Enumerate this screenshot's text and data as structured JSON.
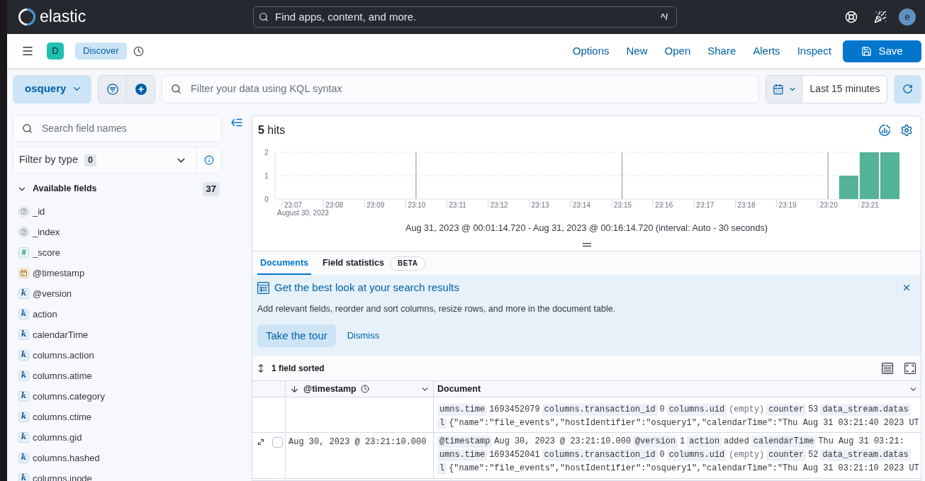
{
  "top_bar": {
    "logo_text": "elastic",
    "search": {
      "placeholder": "Find apps, content, and more.",
      "shortcut": "^/"
    },
    "avatar": "e"
  },
  "app_bar": {
    "app_initial": "D",
    "breadcrumb": "Discover",
    "links": [
      "Options",
      "New",
      "Open",
      "Share",
      "Alerts",
      "Inspect"
    ],
    "save_label": "Save"
  },
  "query_bar": {
    "data_view": "osquery",
    "query": {
      "placeholder": "Filter your data using KQL syntax"
    },
    "time_range": "Last 15 minutes"
  },
  "sidebar": {
    "search": {
      "placeholder": "Search field names"
    },
    "type_filter": {
      "label": "Filter by type",
      "count": "0"
    },
    "section": {
      "title": "Available fields",
      "count": "37",
      "expanded": true
    },
    "fields": [
      {
        "name": "_id",
        "kind": "unknown"
      },
      {
        "name": "_index",
        "kind": "unknown"
      },
      {
        "name": "_score",
        "kind": "number",
        "token": "#"
      },
      {
        "name": "@timestamp",
        "kind": "date"
      },
      {
        "name": "@version",
        "kind": "keyword",
        "token": "k"
      },
      {
        "name": "action",
        "kind": "keyword",
        "token": "k"
      },
      {
        "name": "calendarTime",
        "kind": "keyword",
        "token": "k"
      },
      {
        "name": "columns.action",
        "kind": "keyword",
        "token": "k"
      },
      {
        "name": "columns.atime",
        "kind": "keyword",
        "token": "k"
      },
      {
        "name": "columns.category",
        "kind": "keyword",
        "token": "k"
      },
      {
        "name": "columns.ctime",
        "kind": "keyword",
        "token": "k"
      },
      {
        "name": "columns.gid",
        "kind": "keyword",
        "token": "k"
      },
      {
        "name": "columns.hashed",
        "kind": "keyword",
        "token": "k"
      },
      {
        "name": "columns.inode",
        "kind": "keyword",
        "token": "k"
      }
    ]
  },
  "results": {
    "hits": "**5** hits",
    "chart_data": {
      "type": "bar",
      "xlabel": "August 30, 2023",
      "categories": [
        "23:07",
        null,
        "23:08",
        null,
        "23:09",
        null,
        "23:10",
        null,
        "23:11",
        null,
        "23:12",
        null,
        "23:13",
        null,
        "23:14",
        null,
        "23:15",
        null,
        "23:16",
        null,
        "23:17",
        null,
        "23:18",
        null,
        "23:19",
        null,
        "23:20",
        null,
        "23:21",
        null
      ],
      "values": [
        0,
        0,
        0,
        0,
        0,
        0,
        0,
        0,
        0,
        0,
        0,
        0,
        0,
        0,
        0,
        0,
        0,
        0,
        0,
        0,
        0,
        0,
        0,
        0,
        0,
        0,
        0,
        1,
        2,
        2
      ],
      "ylim": [
        0,
        2
      ],
      "yticks": [
        0,
        1,
        2
      ],
      "ref_lines": [
        {
          "axis": "y",
          "value": 1
        },
        {
          "axis": "y",
          "value": 2
        },
        {
          "axis": "x",
          "value": "23:10"
        },
        {
          "axis": "x",
          "value": "23:15"
        },
        {
          "axis": "x",
          "value": "23:20"
        }
      ]
    },
    "time_range_text": "Aug 31, 2023 @ 00:01:14.720 - Aug 31, 2023 @ 00:16:14.720 (interval: Auto - 30 seconds)"
  },
  "tabs": [
    {
      "label": "Documents",
      "selected": true
    },
    {
      "label": "Field statistics",
      "selected": false,
      "badge": "BETA"
    }
  ],
  "callout": {
    "title": "Get the best look at your search results",
    "body": "Add relevant fields, reorder and sort columns, resize rows, and more in the document table.",
    "buttons": [
      {
        "label": "Take the tour",
        "kind": "primary"
      },
      {
        "label": "Dismiss",
        "kind": "link"
      }
    ]
  },
  "grid": {
    "sort_summary": "1 field sorted",
    "columns": [
      {
        "label": "@timestamp",
        "kind": "time"
      },
      {
        "label": "Document",
        "kind": "document"
      }
    ],
    "rows": [
      {
        "kind": "clipped",
        "lines": [
          [
            {
              "text": "umns.time",
              "kind": "key"
            },
            {
              "text": "1693452079",
              "kind": "value"
            },
            {
              "text": "columns.transaction_id",
              "kind": "key"
            },
            {
              "text": "0",
              "kind": "value"
            },
            {
              "text": "columns.uid",
              "kind": "key"
            },
            {
              "text": "(empty)",
              "kind": "empty"
            },
            {
              "text": "counter",
              "kind": "key"
            },
            {
              "text": "53",
              "kind": "value"
            },
            {
              "text": "data_stream.datas",
              "kind": "key"
            }
          ],
          [
            {
              "text": "l",
              "kind": "key"
            },
            {
              "text": "{\"name\":\"file_events\",\"hostIdentifier\":\"osquery1\",\"calendarTime\":\"Thu Aug 31 03:21:40 2023 UT",
              "kind": "value"
            }
          ]
        ]
      },
      {
        "kind": "full",
        "timestamp": "Aug 30, 2023 @ 23:21:10.000",
        "checked": false,
        "lines": [
          [
            {
              "text": "@timestamp",
              "kind": "key"
            },
            {
              "text": "Aug 30, 2023 @ 23:21:10.000",
              "kind": "value"
            },
            {
              "text": "@version",
              "kind": "key"
            },
            {
              "text": "1",
              "kind": "value"
            },
            {
              "text": "action",
              "kind": "key"
            },
            {
              "text": "added",
              "kind": "value"
            },
            {
              "text": "calendarTime",
              "kind": "key"
            },
            {
              "text": "Thu Aug 31 03:21:",
              "kind": "value"
            }
          ],
          [
            {
              "text": "umns.time",
              "kind": "key"
            },
            {
              "text": "1693452041",
              "kind": "value"
            },
            {
              "text": "columns.transaction_id",
              "kind": "key"
            },
            {
              "text": "0",
              "kind": "value"
            },
            {
              "text": "columns.uid",
              "kind": "key"
            },
            {
              "text": "(empty)",
              "kind": "empty"
            },
            {
              "text": "counter",
              "kind": "key"
            },
            {
              "text": "52",
              "kind": "value"
            },
            {
              "text": "data_stream.datas",
              "kind": "key"
            }
          ],
          [
            {
              "text": "l",
              "kind": "key"
            },
            {
              "text": "{\"name\":\"file_events\",\"hostIdentifier\":\"osquery1\",\"calendarTime\":\"Thu Aug 31 03:21:10 2023 UT",
              "kind": "value"
            }
          ]
        ]
      }
    ]
  }
}
